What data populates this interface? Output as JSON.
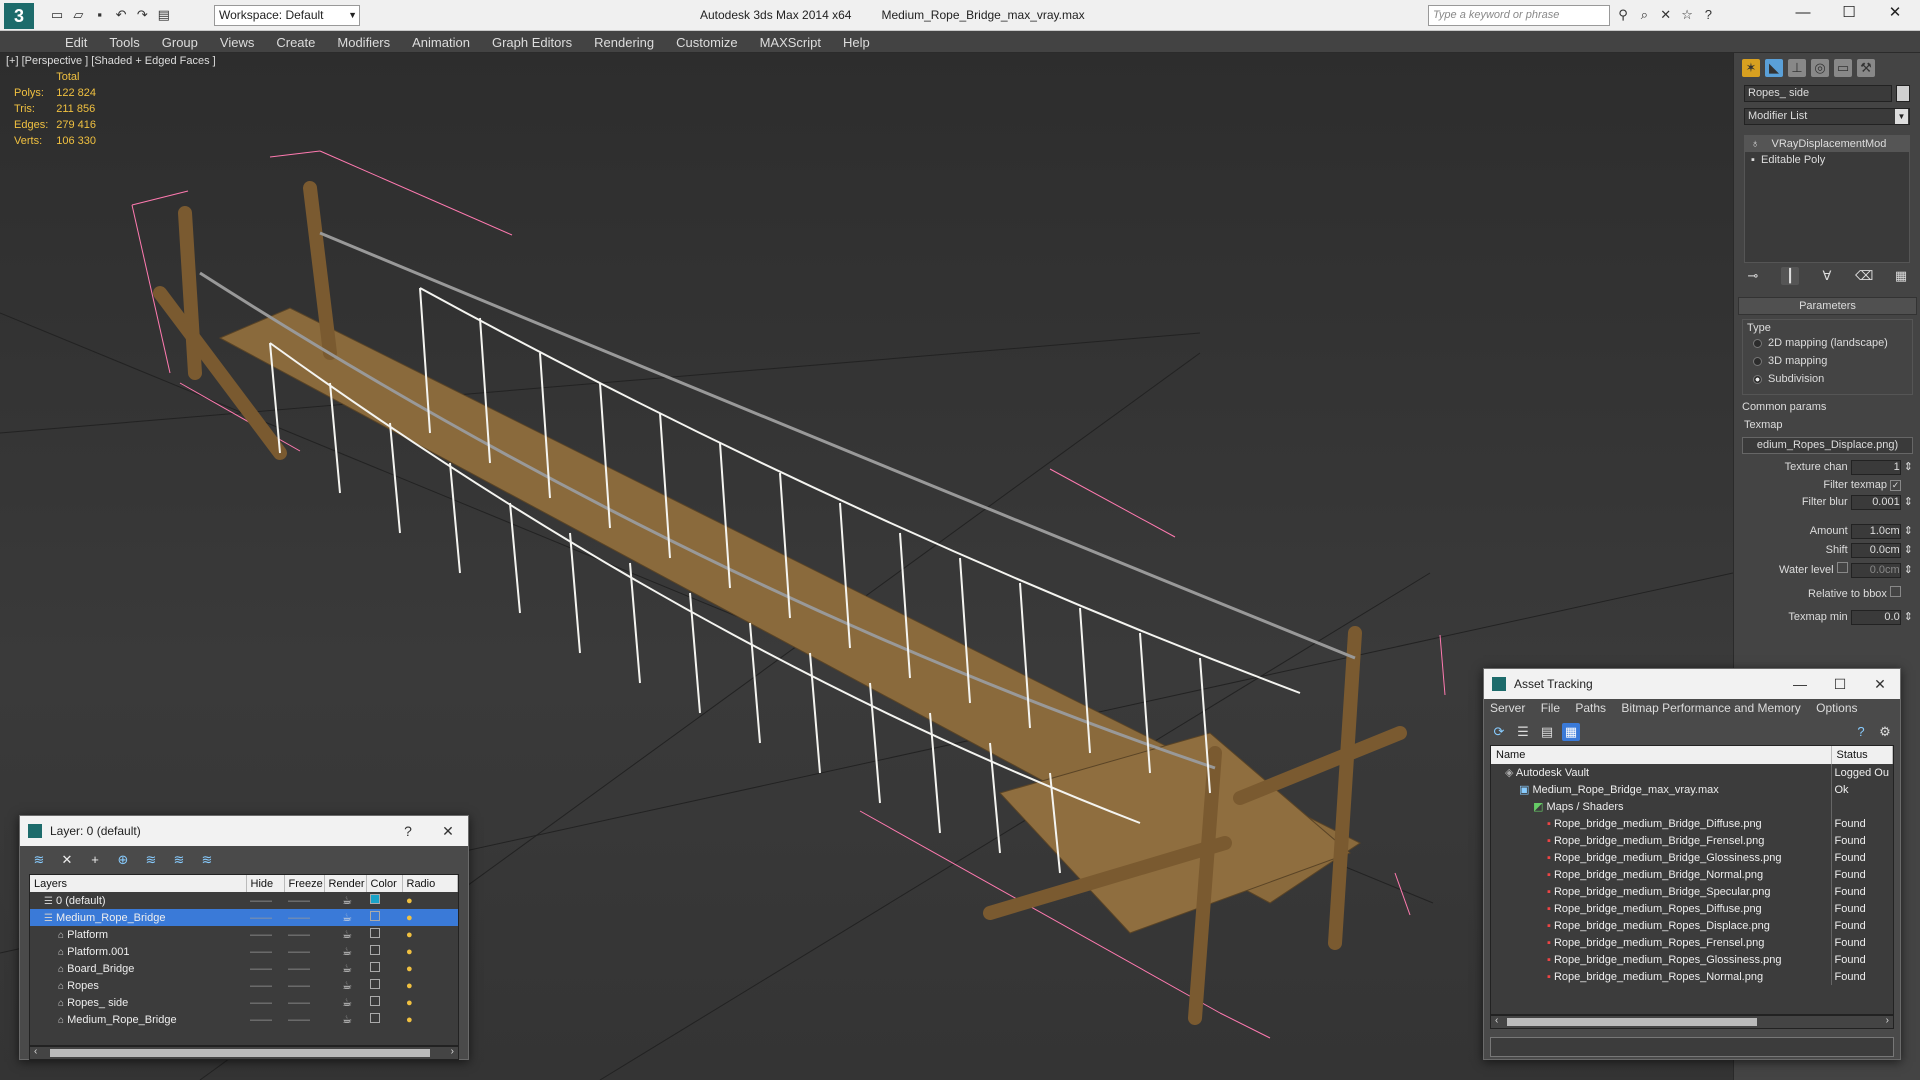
{
  "app": {
    "title": "Autodesk 3ds Max  2014 x64",
    "filename": "Medium_Rope_Bridge_max_vray.max",
    "workspace": "Workspace: Default",
    "search_placeholder": "Type a keyword or phrase"
  },
  "menu": [
    "Edit",
    "Tools",
    "Group",
    "Views",
    "Create",
    "Modifiers",
    "Animation",
    "Graph Editors",
    "Rendering",
    "Customize",
    "MAXScript",
    "Help"
  ],
  "viewport": {
    "label": "[+] [Perspective ] [Shaded + Edged Faces ]",
    "stats": {
      "header": "Total",
      "rows": [
        {
          "k": "Polys:",
          "v": "122 824"
        },
        {
          "k": "Tris:",
          "v": "211 856"
        },
        {
          "k": "Edges:",
          "v": "279 416"
        },
        {
          "k": "Verts:",
          "v": "106 330"
        }
      ]
    }
  },
  "command_panel": {
    "object_name": "Ropes_ side",
    "modifier_list": "Modifier List",
    "stack": [
      "VRayDisplacementMod",
      "Editable Poly"
    ],
    "parameters_title": "Parameters",
    "type_label": "Type",
    "type_options": [
      {
        "label": "2D mapping (landscape)",
        "selected": false
      },
      {
        "label": "3D mapping",
        "selected": false
      },
      {
        "label": "Subdivision",
        "selected": true
      }
    ],
    "common_params": "Common params",
    "texmap_label": "Texmap",
    "texmap_value": "edium_Ropes_Displace.png)",
    "texture_chan_label": "Texture chan",
    "texture_chan": "1",
    "filter_texmap": "Filter texmap",
    "filter_blur_label": "Filter blur",
    "filter_blur": "0.001",
    "amount_label": "Amount",
    "amount": "1.0cm",
    "shift_label": "Shift",
    "shift": "0.0cm",
    "water_label": "Water level",
    "water": "0.0cm",
    "relative_label": "Relative to bbox",
    "texmap_min_label": "Texmap min",
    "texmap_min": "0.0"
  },
  "layer_window": {
    "title": "Layer: 0 (default)",
    "columns": [
      "Layers",
      "Hide",
      "Freeze",
      "Render",
      "Color",
      "Radio"
    ],
    "rows": [
      {
        "name": "0 (default)",
        "indent": 1,
        "color": "#1aa3c8",
        "selected": false
      },
      {
        "name": "Medium_Rope_Bridge",
        "indent": 1,
        "color": "#3a7ad8",
        "selected": true
      },
      {
        "name": "Platform",
        "indent": 2,
        "color": "#3a3a3a",
        "selected": false
      },
      {
        "name": "Platform.001",
        "indent": 2,
        "color": "#3a3a3a",
        "selected": false
      },
      {
        "name": "Board_Bridge",
        "indent": 2,
        "color": "#3a3a3a",
        "selected": false
      },
      {
        "name": "Ropes",
        "indent": 2,
        "color": "#3a3a3a",
        "selected": false
      },
      {
        "name": "Ropes_ side",
        "indent": 2,
        "color": "#3a3a3a",
        "selected": false
      },
      {
        "name": "Medium_Rope_Bridge",
        "indent": 2,
        "color": "#3a3a3a",
        "selected": false
      }
    ]
  },
  "asset_window": {
    "title": "Asset Tracking",
    "menu": [
      "Server",
      "File",
      "Paths",
      "Bitmap Performance and Memory",
      "Options"
    ],
    "columns": [
      "Name",
      "Status"
    ],
    "rows": [
      {
        "name": "Autodesk Vault",
        "status": "Logged Ou",
        "indent": 1,
        "kind": "vault"
      },
      {
        "name": "Medium_Rope_Bridge_max_vray.max",
        "status": "Ok",
        "indent": 2,
        "kind": "max"
      },
      {
        "name": "Maps / Shaders",
        "status": "",
        "indent": 3,
        "kind": "maps"
      },
      {
        "name": "Rope_bridge_medium_Bridge_Diffuse.png",
        "status": "Found",
        "indent": 4,
        "kind": "png"
      },
      {
        "name": "Rope_bridge_medium_Bridge_Frensel.png",
        "status": "Found",
        "indent": 4,
        "kind": "png"
      },
      {
        "name": "Rope_bridge_medium_Bridge_Glossiness.png",
        "status": "Found",
        "indent": 4,
        "kind": "png"
      },
      {
        "name": "Rope_bridge_medium_Bridge_Normal.png",
        "status": "Found",
        "indent": 4,
        "kind": "png"
      },
      {
        "name": "Rope_bridge_medium_Bridge_Specular.png",
        "status": "Found",
        "indent": 4,
        "kind": "png"
      },
      {
        "name": "Rope_bridge_medium_Ropes_Diffuse.png",
        "status": "Found",
        "indent": 4,
        "kind": "png"
      },
      {
        "name": "Rope_bridge_medium_Ropes_Displace.png",
        "status": "Found",
        "indent": 4,
        "kind": "png"
      },
      {
        "name": "Rope_bridge_medium_Ropes_Frensel.png",
        "status": "Found",
        "indent": 4,
        "kind": "png"
      },
      {
        "name": "Rope_bridge_medium_Ropes_Glossiness.png",
        "status": "Found",
        "indent": 4,
        "kind": "png"
      },
      {
        "name": "Rope_bridge_medium_Ropes_Normal.png",
        "status": "Found",
        "indent": 4,
        "kind": "png"
      }
    ]
  }
}
